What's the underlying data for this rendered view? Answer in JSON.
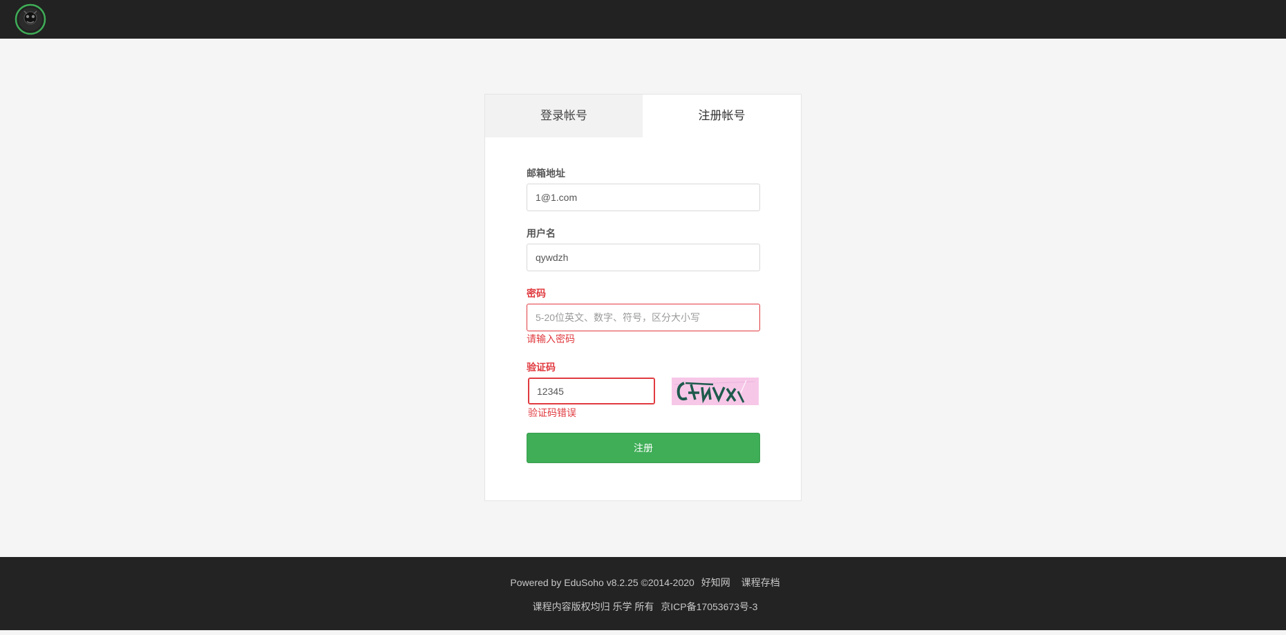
{
  "tabs": {
    "login": "登录帐号",
    "register": "注册帐号"
  },
  "form": {
    "email_label": "邮箱地址",
    "email_value": "1@1.com",
    "username_label": "用户名",
    "username_value": "qywdzh",
    "password_label": "密码",
    "password_placeholder": "5-20位英文、数字、符号，区分大小写",
    "password_error": "请输入密码",
    "captcha_label": "验证码",
    "captcha_value": "12345",
    "captcha_error": "验证码错误",
    "submit_label": "注册"
  },
  "footer": {
    "powered_by": "Powered by EduSoho v8.2.25 ©2014-2020",
    "link_1": "好知网",
    "link_2": "课程存档",
    "copyright": "课程内容版权均归 乐学 所有",
    "icp": "京ICP备17053673号-3"
  },
  "colors": {
    "topbar": "#222222",
    "accent_green": "#3fae57",
    "error_red": "#e0393e"
  }
}
